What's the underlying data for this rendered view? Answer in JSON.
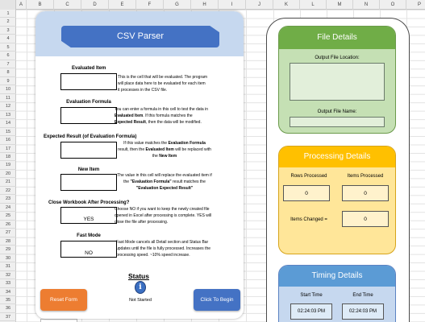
{
  "sheet": {
    "columns": [
      "A",
      "B",
      "C",
      "D",
      "E",
      "F",
      "G",
      "H",
      "I",
      "J",
      "K",
      "L",
      "M",
      "N",
      "O",
      "P"
    ],
    "rows": [
      "1",
      "2",
      "3",
      "4",
      "5",
      "6",
      "7",
      "8",
      "9",
      "10",
      "11",
      "12",
      "13",
      "14",
      "15",
      "16",
      "17",
      "18",
      "19",
      "20",
      "21",
      "22",
      "23",
      "24",
      "25",
      "26",
      "27",
      "28",
      "29",
      "30",
      "31",
      "32",
      "33",
      "34",
      "35",
      "36",
      "37"
    ]
  },
  "parser": {
    "title": "CSV Parser",
    "fields": {
      "evaluated_item": {
        "label": "Evaluated Item",
        "value": "",
        "desc": "This is the cell that will be evaluated. The program will place data here to be evaluated for each item it processes in the CSV file."
      },
      "evaluation_formula": {
        "label": "Evaluation Formula",
        "value": "",
        "desc_1": "You can enter a formula in this cell to test the data in ",
        "desc_b1": "Evaluated Item",
        "desc_2": ". If this formula matches the ",
        "desc_b2": "Expected Result",
        "desc_3": ", then the data will be modified."
      },
      "expected_result": {
        "label": "Expected Result (of Evaluation Formula)",
        "value": "",
        "desc_1": "If this value matches the ",
        "desc_b1": "Evaluation Formula",
        "desc_2": " result, then the ",
        "desc_b2": "Evaluated Item",
        "desc_3": " will be replaced with the ",
        "desc_b3": "New Item"
      },
      "new_item": {
        "label": "New Item",
        "value": "",
        "desc_1": "The value in this cell will replace the evaluated item if the ",
        "desc_b1": "\"Evaluation Formula\"",
        "desc_2": " result matches the ",
        "desc_b2": "\"Evaluation Expected Result\""
      },
      "close_workbook": {
        "label": "Close Workbook After Processing?",
        "value": "YES",
        "desc": "Choose NO if you want to keep the newly created file opened in Excel after processing is complete. YES will close the file after processing."
      },
      "fast_mode": {
        "label": "Fast Mode",
        "value": "NO",
        "desc": "Fast Mode cancels all Detail section and Status Bar updates until the file is fully processed. Increases the processing speed. ~10% speed increase."
      }
    },
    "status": {
      "label": "Status",
      "icon": "info-icon",
      "icon_glyph": "i",
      "text": "Not Started"
    },
    "buttons": {
      "reset": "Reset Form",
      "begin": "Click To Begin"
    }
  },
  "details": {
    "file": {
      "title": "File Details",
      "output_location_label": "Output File Location:",
      "output_location_value": "",
      "output_name_label": "Output File Name:",
      "output_name_value": ""
    },
    "processing": {
      "title": "Processing Details",
      "rows_processed_label": "Rows Processed",
      "rows_processed": "0",
      "items_processed_label": "Items Processed",
      "items_processed": "0",
      "items_changed_label": "Items Changed =",
      "items_changed": "0"
    },
    "timing": {
      "title": "Timing Details",
      "start_label": "Start Time",
      "start_time": "02:24:03 PM",
      "end_label": "End Time",
      "end_time": "02:24:03 PM"
    }
  },
  "colors": {
    "title_blue": "#4472c4",
    "reset_orange": "#ed7d31",
    "file_green": "#70ad47",
    "processing_gold": "#ffc000",
    "timing_blue": "#5b9bd5"
  }
}
